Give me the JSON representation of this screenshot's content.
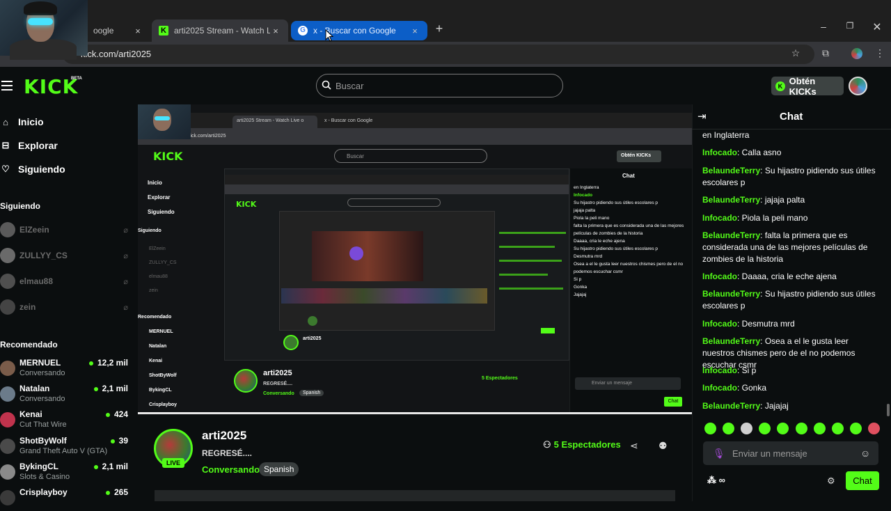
{
  "browser": {
    "tabs": [
      {
        "title": "oogle"
      },
      {
        "title": "arti2025 Stream - Watch Live o"
      },
      {
        "title": "x - Buscar con Google"
      }
    ],
    "url": "kick.com/arti2025",
    "new_tab": "+",
    "close": "×"
  },
  "header": {
    "logo": "KICK",
    "beta": "BETA",
    "search_placeholder": "Buscar",
    "kicks_button": "Obtén KICKs"
  },
  "sidebar": {
    "nav": [
      {
        "label": "Inicio"
      },
      {
        "label": "Explorar"
      },
      {
        "label": "Siguiendo"
      }
    ],
    "following_title": "Siguiendo",
    "following": [
      {
        "name": "ElZeein"
      },
      {
        "name": "ZULLYY_CS"
      },
      {
        "name": "elmau88"
      },
      {
        "name": "zein"
      }
    ],
    "recommended_title": "Recomendado",
    "recommended": [
      {
        "name": "MERNUEL",
        "category": "Conversando",
        "viewers": "12,2 mil",
        "color": "#7a5c4a"
      },
      {
        "name": "Natalan",
        "category": "Conversando",
        "viewers": "2,1 mil",
        "color": "#6b7b8a"
      },
      {
        "name": "Kenai",
        "category": "Cut That Wire",
        "viewers": "424",
        "color": "#c0334d"
      },
      {
        "name": "ShotByWolf",
        "category": "Grand Theft Auto V (GTA)",
        "viewers": "39",
        "color": "#4a4a4a"
      },
      {
        "name": "BykingCL",
        "category": "Slots & Casino",
        "viewers": "2,1 mil",
        "color": "#8a8a8a"
      },
      {
        "name": "Crisplayboy",
        "category": "",
        "viewers": "265",
        "color": "#3a3a3a"
      }
    ]
  },
  "stream": {
    "name": "arti2025",
    "title": "REGRESÉ....",
    "category": "Conversando",
    "language": "Spanish",
    "live": "LIVE",
    "viewers": "5 Espectadores"
  },
  "chat": {
    "title": "Chat",
    "messages": [
      {
        "user": "",
        "text": "en Inglaterra"
      },
      {
        "user": "Infocado",
        "text": "Calla asno"
      },
      {
        "user": "BelaundeTerry",
        "text": "Su hijastro pidiendo sus útiles escolares p"
      },
      {
        "user": "BelaundeTerry",
        "text": "jajaja palta"
      },
      {
        "user": "Infocado",
        "text": "Piola la peli mano"
      },
      {
        "user": "BelaundeTerry",
        "text": "falta la primera que es considerada una de las mejores películas de zombies de la historia"
      },
      {
        "user": "Infocado",
        "text": "Daaaa, cria le eche ajena"
      },
      {
        "user": "BelaundeTerry",
        "text": "Su hijastro pidiendo sus útiles escolares p"
      },
      {
        "user": "Infocado",
        "text": "Desmutra mrd"
      },
      {
        "user": "BelaundeTerry",
        "text": "Osea a el le gusta leer nuestros chismes pero de el no podemos escuchar csmr"
      },
      {
        "user": "Infocado",
        "text": "Si p"
      },
      {
        "user": "Infocado",
        "text": "Gonka"
      },
      {
        "user": "BelaundeTerry",
        "text": "Jajajaj"
      }
    ],
    "input_placeholder": "Enviar un mensaje",
    "send_button": "Chat",
    "points": "∞"
  },
  "colors": {
    "accent": "#53fc18",
    "background": "#0b0e0f",
    "tab_highlight": "#0c5ec7"
  }
}
